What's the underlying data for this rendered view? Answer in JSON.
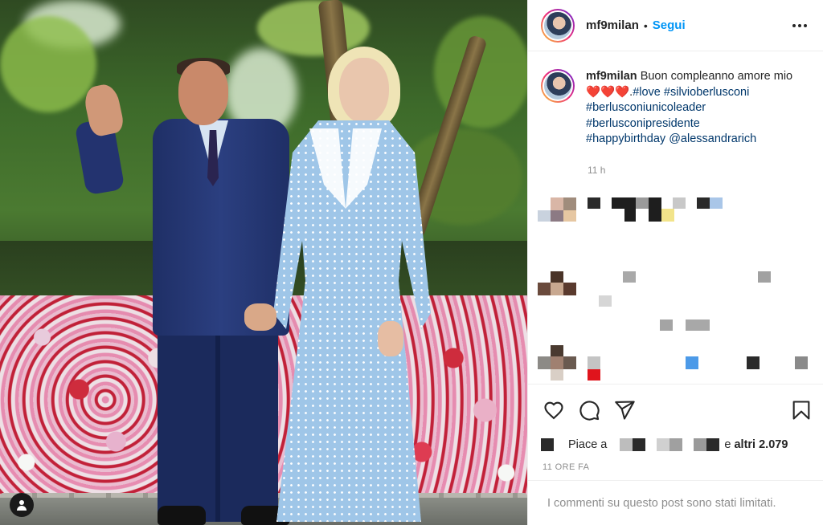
{
  "post": {
    "username": "mf9milan",
    "follow_label": "Segui",
    "separator": "•",
    "caption": {
      "username": "mf9milan",
      "text_part1": " Buon compleanno amore mio",
      "hearts": "❤️❤️❤️",
      "text_part2": ".",
      "hashtags": [
        "#love",
        "#silvioberlusconi",
        "#berlusconiunicoleader",
        "#berlusconipresidente",
        "#happybirthday"
      ],
      "mention": "@alessandrarich"
    },
    "caption_time": "11 h",
    "likes": {
      "prefix": "Piace a",
      "suffix_word": "e",
      "others": "altri 2.079"
    },
    "post_time": "11 ORE FA",
    "comments_limited": "I commenti su questo post sono stati limitati."
  },
  "icons": {
    "more": "more-horizontal-icon",
    "like": "heart-outline-icon",
    "comment": "comment-bubble-icon",
    "share": "paper-plane-icon",
    "save": "bookmark-icon",
    "user_tag": "user-tag-icon"
  },
  "colors": {
    "link_blue": "#0095f6",
    "hashtag": "#00376b",
    "secondary_text": "#8e8e8e",
    "heart_red": "#e0152a"
  }
}
